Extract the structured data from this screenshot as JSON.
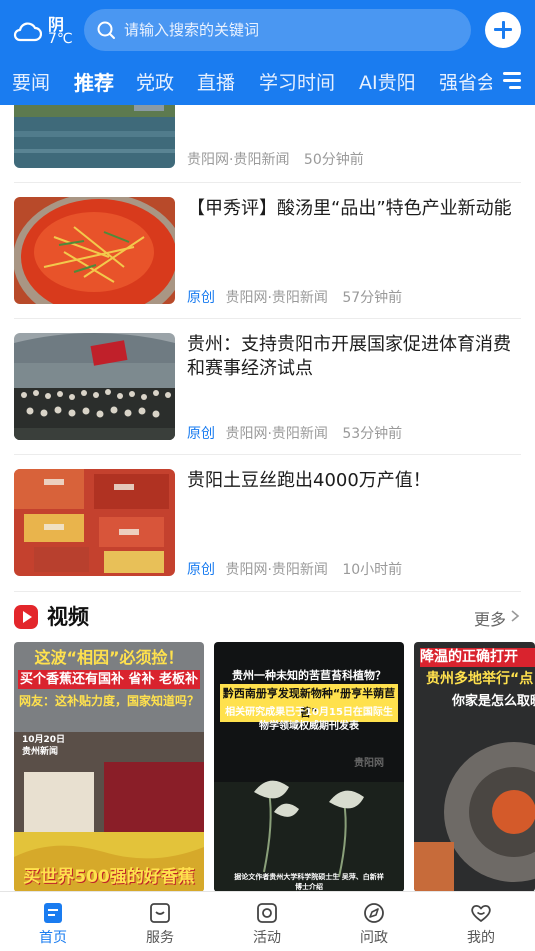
{
  "header": {
    "weather": {
      "condition": "阴",
      "temperature": "7℃",
      "icon": "cloud-icon"
    },
    "search": {
      "placeholder": "请输入搜索的关键词"
    },
    "add_button_icon": "plus-icon",
    "tabs": [
      "要闻",
      "推荐",
      "党政",
      "直播",
      "学习时间",
      "AI贵阳",
      "强省会"
    ],
    "active_tab": "推荐",
    "menu_icon": "menu-icon"
  },
  "news": [
    {
      "title": "",
      "original": "",
      "source": "贵阳网·贵阳新闻",
      "time": "50分钟前"
    },
    {
      "title": "【甲秀评】酸汤里“品出”特色产业新动能",
      "original": "原创",
      "source": "贵阳网·贵阳新闻",
      "time": "57分钟前"
    },
    {
      "title": "贵州：支持贵阳市开展国家促进体育消费和赛事经济试点",
      "original": "原创",
      "source": "贵阳网·贵阳新闻",
      "time": "53分钟前"
    },
    {
      "title": "贵阳土豆丝跑出4000万产值！",
      "original": "原创",
      "source": "贵阳网·贵阳新闻",
      "time": "10小时前"
    }
  ],
  "video_section": {
    "title": "视频",
    "more": "更多",
    "videos": [
      {
        "caption_top": "这波“相因”必须捡！",
        "caption_2": "买个香蕉还有国补 省补 老板补",
        "caption_3": "网友：这补贴力度，国家知道吗？",
        "date": "10月20日",
        "place": "贵州新闻",
        "caption_bottom": "买世界500强的好香蕉"
      },
      {
        "caption_top": "贵州一种未知的苦苣苔科植物？",
        "caption_2": "黔西南册亨发现新物种“册亨半蒴苣苔”",
        "caption_3": "相关研究成果已于10月15日在国际生物学领域权威期刊发表",
        "watermark": "贵阳网",
        "caption_bottom": "据论文作者贵州大学科学院硕士生 吴萍、白新祥博士介绍"
      },
      {
        "caption_top": "降温的正确打开",
        "caption_2": "贵州多地举行“点",
        "caption_3": "你家是怎么取暖"
      }
    ]
  },
  "bottom_nav": [
    {
      "label": "首页",
      "icon": "home-icon",
      "active": true
    },
    {
      "label": "服务",
      "icon": "service-icon",
      "active": false
    },
    {
      "label": "活动",
      "icon": "activity-icon",
      "active": false
    },
    {
      "label": "问政",
      "icon": "inquiry-icon",
      "active": false
    },
    {
      "label": "我的",
      "icon": "heart-icon",
      "active": false
    }
  ],
  "colors": {
    "brand": "#1a7cf0",
    "video_accent": "#e3262b",
    "meta": "#9a9a9a"
  }
}
